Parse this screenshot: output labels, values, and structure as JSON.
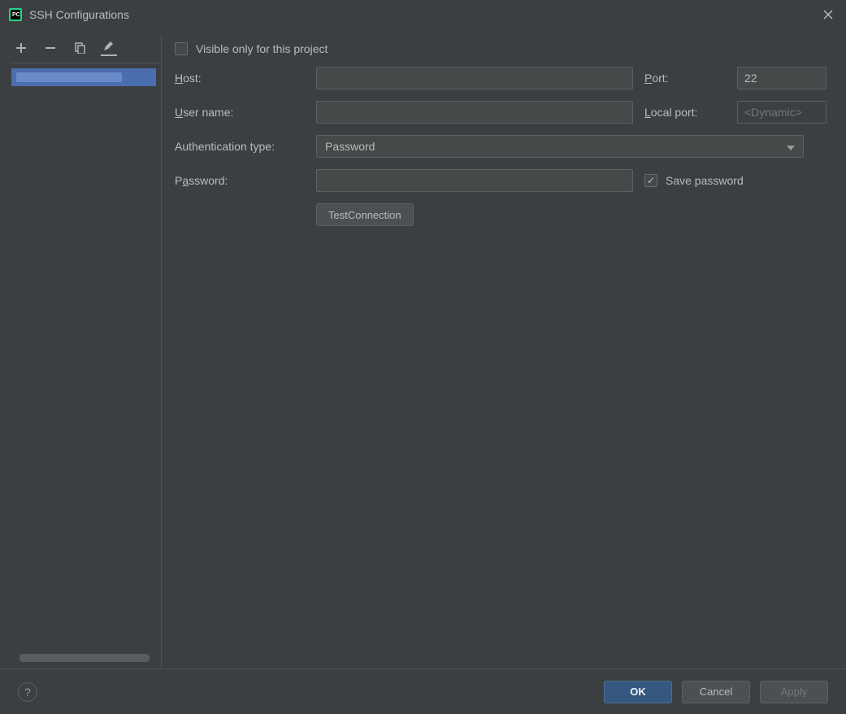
{
  "window": {
    "title": "SSH Configurations"
  },
  "sidebar": {
    "items": [
      {
        "label": ""
      }
    ]
  },
  "form": {
    "visible_only_label": "Visible only for this project",
    "visible_only_checked": false,
    "host_label": "Host:",
    "host_value": "",
    "port_label": "Port:",
    "port_value": "22",
    "username_label": "User name:",
    "username_value": "",
    "localport_label": "Local port:",
    "localport_placeholder": "<Dynamic>",
    "authtype_label": "Authentication type:",
    "authtype_value": "Password",
    "password_label": "Password:",
    "password_value": "",
    "save_password_label": "Save password",
    "save_password_checked": true,
    "test_connection_label": "Test Connection"
  },
  "footer": {
    "ok": "OK",
    "cancel": "Cancel",
    "apply": "Apply"
  }
}
